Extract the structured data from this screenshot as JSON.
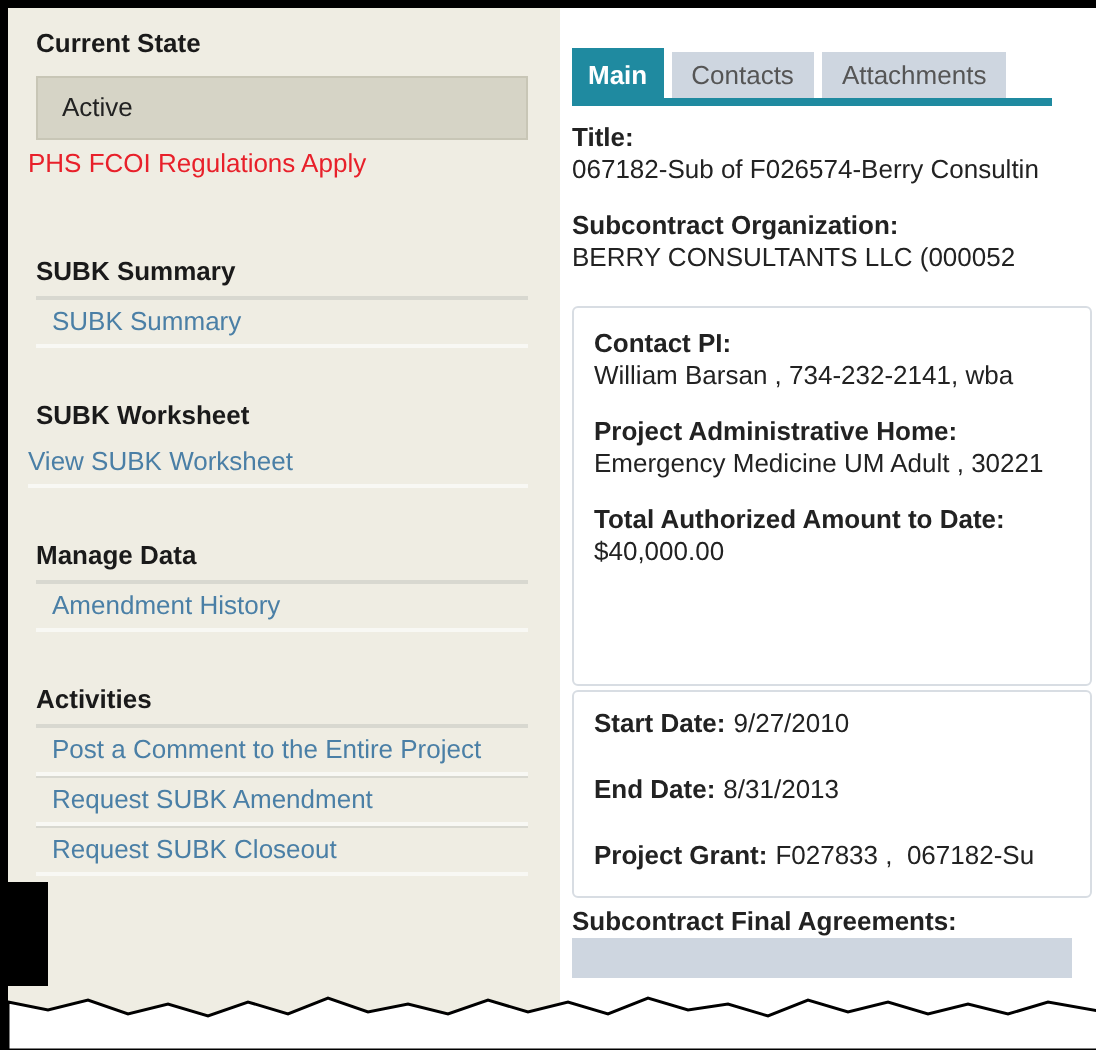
{
  "sidebar": {
    "current_state": {
      "heading": "Current State",
      "value": "Active",
      "notice": "PHS FCOI Regulations Apply"
    },
    "sections": [
      {
        "heading": "SUBK Summary",
        "indented": true,
        "links": [
          "SUBK Summary"
        ]
      },
      {
        "heading": "SUBK Worksheet",
        "indented": false,
        "links": [
          "View SUBK Worksheet"
        ]
      },
      {
        "heading": "Manage Data",
        "indented": true,
        "links": [
          "Amendment History"
        ]
      },
      {
        "heading": "Activities",
        "indented": true,
        "links": [
          "Post a Comment to the Entire Project",
          "Request SUBK Amendment",
          "Request SUBK Closeout"
        ]
      }
    ]
  },
  "tabs": [
    {
      "label": "Main",
      "selected": true
    },
    {
      "label": "Contacts",
      "selected": false
    },
    {
      "label": "Attachments",
      "selected": false
    }
  ],
  "fields": [
    {
      "label": "Title:",
      "value": "067182-Sub of F026574-Berry Consultin"
    },
    {
      "label": "Subcontract Organization:",
      "value": "BERRY CONSULTANTS LLC (000052"
    }
  ],
  "contact_panel": [
    {
      "label": "Contact PI:",
      "value": "William Barsan , 734-232-2141, wba"
    },
    {
      "label": "Project Administrative Home:",
      "value": "Emergency Medicine UM Adult , 30221"
    },
    {
      "label": "Total Authorized Amount to Date:",
      "value": "$40,000.00"
    }
  ],
  "dates_panel": [
    {
      "label": "Start Date:",
      "value": "9/27/2010"
    },
    {
      "label": "End Date:",
      "value": "8/31/2013"
    },
    {
      "label": "Project Grant:",
      "value": "F027833 ,  067182-Su"
    }
  ],
  "final_agreements": {
    "heading": "Subcontract Final Agreements:"
  }
}
